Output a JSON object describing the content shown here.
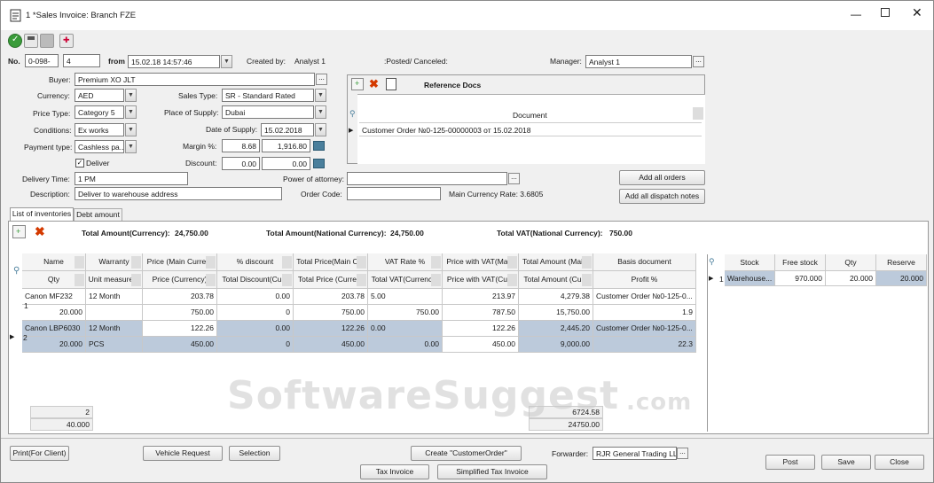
{
  "window": {
    "title": "1 *Sales Invoice: Branch FZE"
  },
  "header": {
    "no_label": "No.",
    "no_prefix": "0-098-",
    "no_value": "4",
    "from_label": "from",
    "from_value": "15.02.18 14:57:46",
    "created_by_label": "Created by:",
    "created_by_value": "Analyst 1",
    "posted_label": ":Posted/ Canceled:",
    "manager_label": "Manager:",
    "manager_value": "Analyst 1"
  },
  "form": {
    "buyer_label": "Buyer:",
    "buyer_value": "Premium XO JLT",
    "currency_label": "Currency:",
    "currency_value": "AED",
    "sales_type_label": "Sales Type:",
    "sales_type_value": "SR - Standard Rated",
    "price_type_label": "Price Type:",
    "price_type_value": "Category 5",
    "place_label": "Place of Supply:",
    "place_value": "Dubai",
    "conditions_label": "Conditions:",
    "conditions_value": "Ex works",
    "date_supply_label": "Date of Supply:",
    "date_supply_value": "15.02.2018",
    "payment_label": "Payment type:",
    "payment_value": "Cashless pa...",
    "margin_label": "Margin %:",
    "margin_value": "8.68",
    "margin_amount": "1,916.80",
    "deliver_label": "Deliver",
    "discount_label": "Discount:",
    "discount_value": "0.00",
    "discount_amount": "0.00",
    "delivery_time_label": "Delivery Time:",
    "delivery_time_value": "1 PM",
    "power_label": "Power of attorney:",
    "description_label": "Description:",
    "description_value": "Deliver to warehouse address",
    "order_code_label": "Order Code:",
    "main_rate": "Main Currency Rate: 3.6805"
  },
  "refdocs": {
    "title": "Reference Docs",
    "col": "Document",
    "row": "Customer Order №0-125-00000003 от 15.02.2018",
    "add_orders": "Add all orders",
    "add_dispatch": "Add all dispatch notes"
  },
  "tabs": [
    "List of inventories",
    "Debt amount"
  ],
  "totals": {
    "currency_label": "Total Amount(Currency):",
    "currency_value": "24,750.00",
    "national_label": "Total Amount(National Currency):",
    "national_value": "24,750.00",
    "vat_label": "Total VAT(National Currency):",
    "vat_value": "750.00"
  },
  "grid": {
    "headers1": [
      "Name",
      "Warranty",
      "Price (Main Curre...",
      "% discount",
      "Total Price(Main C...",
      "VAT Rate %",
      "Price with VAT(Ma...",
      "Total Amount (Mai...",
      "Basis document"
    ],
    "headers2": [
      "Qty",
      "Unit measure...",
      "Price (Currency)",
      "Total Discount(Cu...",
      "Total Price (Curre...",
      "Total VAT(Currency)",
      "Price with VAT(Cu...",
      "Total Amount (Cu...",
      "Profit %"
    ],
    "rows": [
      {
        "num": "1",
        "a": [
          "Canon MF232",
          "12 Month",
          "203.78",
          "0.00",
          "203.78",
          "5.00",
          "213.97",
          "4,279.38",
          "Customer Order №0-125-0..."
        ],
        "b": [
          "20.000",
          "",
          "750.00",
          "0",
          "750.00",
          "750.00",
          "787.50",
          "15,750.00",
          "1.9"
        ]
      },
      {
        "num": "2",
        "a": [
          "Canon LBP6030",
          "12 Month",
          "122.26",
          "0.00",
          "122.26",
          "0.00",
          "122.26",
          "2,445.20",
          "Customer Order №0-125-0..."
        ],
        "b": [
          "20.000",
          "PCS",
          "450.00",
          "0",
          "450.00",
          "0.00",
          "450.00",
          "9,000.00",
          "22.3"
        ]
      }
    ],
    "footer_count": "2",
    "footer_qty": "40.000",
    "footer_total1": "6724.58",
    "footer_total2": "24750.00"
  },
  "stock": {
    "headers": [
      "Stock",
      "Free stock",
      "Qty",
      "Reserve"
    ],
    "row_num": "1",
    "row": [
      "Warehouse...",
      "970.000",
      "20.000",
      "20.000"
    ]
  },
  "bottom": {
    "print": "Print(For Client)",
    "vehicle": "Vehicle Request",
    "selection": "Selection",
    "create": "Create \"CustomerOrder\"",
    "forwarder_label": "Forwarder:",
    "forwarder_value": "RJR General Trading LLC",
    "tax_invoice": "Tax Invoice",
    "simplified": "Simplified Tax Invoice",
    "post": "Post",
    "save": "Save",
    "close": "Close"
  },
  "watermark": {
    "main": "SoftwareSuggest",
    ".com": ".com"
  },
  "colors": {
    "selection": "#bccadb",
    "accent": "#4a7f9c"
  }
}
